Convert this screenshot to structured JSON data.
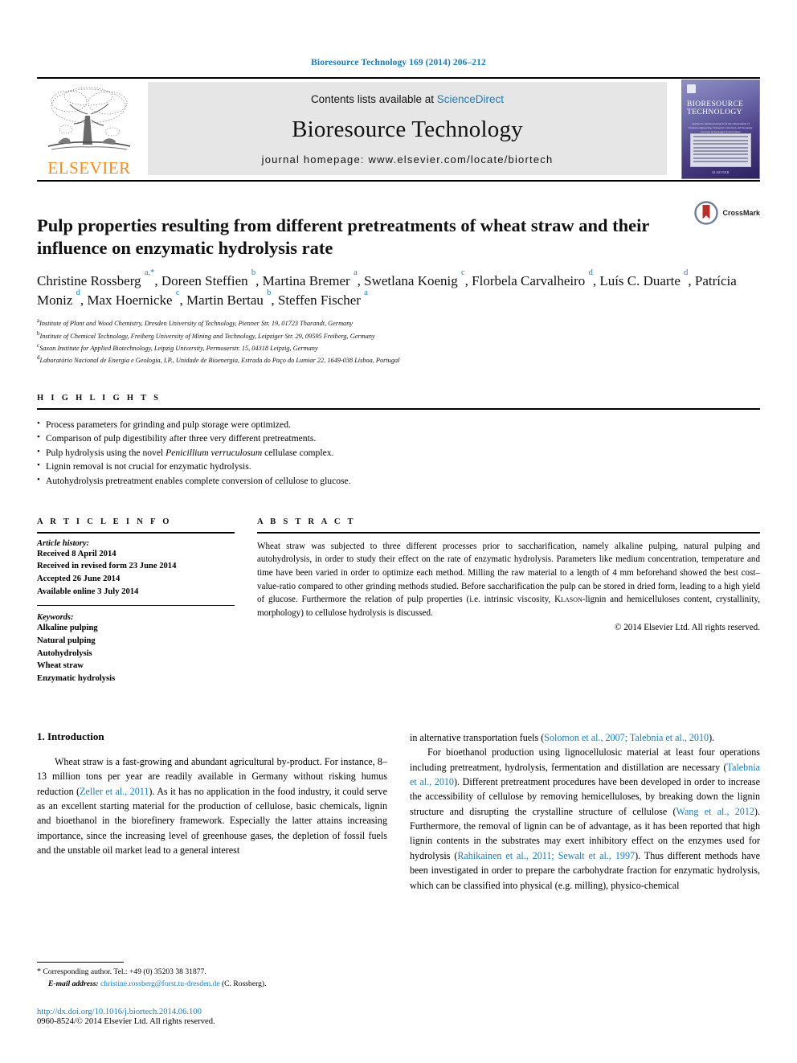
{
  "running_head": "Bioresource Technology 169 (2014) 206–212",
  "banner": {
    "publisher_logo_text": "ELSEVIER",
    "contents_prefix": "Contents lists available at ",
    "contents_link": "ScienceDirect",
    "journal_name": "Bioresource Technology",
    "homepage": "journal homepage: www.elsevier.com/locate/biortech",
    "cover_title_line1": "BIORESOURCE",
    "cover_title_line2": "TECHNOLOGY",
    "cover_subtitle": "Applied in chemical research for the advancement of biomass engineering, biological conversion and bioenergy recovery technologies from biomass",
    "cover_publisher": "ELSEVIER"
  },
  "article": {
    "title": "Pulp properties resulting from different pretreatments of wheat straw and their influence on enzymatic hydrolysis rate",
    "crossmark_label": "CrossMark",
    "authors_html": "Christine Rossberg <sup>a,*</sup>, Doreen Steffien <sup>b</sup>, Martina Bremer <sup>a</sup>, Swetlana Koenig <sup>c</sup>, Florbela Carvalheiro <sup>d</sup>, Luís C. Duarte <sup>d</sup>, Patrícia Moniz <sup>d</sup>, Max Hoernicke <sup>c</sup>, Martin Bertau <sup>b</sup>, Steffen Fischer <sup>a</sup>",
    "affiliations": [
      {
        "marker": "a",
        "text": "Institute of Plant and Wood Chemistry, Dresden University of Technology, Pienner Str. 19, 01723 Tharandt, Germany"
      },
      {
        "marker": "b",
        "text": "Institute of Chemical Technology, Freiberg University of Mining and Technology, Leipziger Str. 29, 09595 Freiberg, Germany"
      },
      {
        "marker": "c",
        "text": "Saxon Institute for Applied Biotechnology, Leipzig University, Permoserstr. 15, 04318 Leipzig, Germany"
      },
      {
        "marker": "d",
        "text": "Laboratório Nacional de Energia e Geologia, I.P., Unidade de Bioenergia, Estrada do Paço do Lumiar 22, 1649-038 Lisboa, Portugal"
      }
    ]
  },
  "highlights": {
    "heading": "H I G H L I G H T S",
    "items_html": [
      "Process parameters for grinding and pulp storage were optimized.",
      "Comparison of pulp digestibility after three very different pretreatments.",
      "Pulp hydrolysis using the novel <em>Penicillium verruculosum</em> cellulase complex.",
      "Lignin removal is not crucial for enzymatic hydrolysis.",
      "Autohydrolysis pretreatment enables complete conversion of cellulose to glucose."
    ]
  },
  "article_info": {
    "heading": "A R T I C L E    I N F O",
    "history_label": "Article history:",
    "history": [
      "Received 8 April 2014",
      "Received in revised form 23 June 2014",
      "Accepted 26 June 2014",
      "Available online 3 July 2014"
    ],
    "keywords_label": "Keywords:",
    "keywords": [
      "Alkaline pulping",
      "Natural pulping",
      "Autohydrolysis",
      "Wheat straw",
      "Enzymatic hydrolysis"
    ]
  },
  "abstract": {
    "heading": "A B S T R A C T",
    "body_html": "Wheat straw was subjected to three different processes prior to saccharification, namely alkaline pulping, natural pulping and autohydrolysis, in order to study their effect on the rate of enzymatic hydrolysis. Parameters like medium concentration, temperature and time have been varied in order to optimize each method. Milling the raw material to a length of 4 mm beforehand showed the best cost–value-ratio compared to other grinding methods studied. Before saccharification the pulp can be stored in dried form, leading to a high yield of glucose. Furthermore the relation of pulp properties (i.e. intrinsic viscosity, <span class=\"abs-smallcaps\">Klason</span>-lignin and hemicelluloses content, crystallinity, morphology) to cellulose hydrolysis is discussed.",
    "copyright": "© 2014 Elsevier Ltd. All rights reserved."
  },
  "introduction": {
    "heading": "1. Introduction",
    "left_paragraphs_html": [
      "Wheat straw is a fast-growing and abundant agricultural by-product. For instance, 8–13 million tons per year are readily available in Germany without risking humus reduction (<span class=\"ref\">Zeller et al., 2011</span>). As it has no application in the food industry, it could serve as an excellent starting material for the production of cellulose, basic chemicals, lignin and bioethanol in the biorefinery framework. Especially the latter attains increasing importance, since the increasing level of greenhouse gases, the depletion of fossil fuels and the unstable oil market lead to a general interest"
    ],
    "right_paragraphs_html": [
      "in alternative transportation fuels (<span class=\"ref\">Solomon et al., 2007; Talebnia et al., 2010</span>).",
      "For bioethanol production using lignocellulosic material at least four operations including pretreatment, hydrolysis, fermentation and distillation are necessary (<span class=\"ref\">Talebnia et al., 2010</span>). Different pretreatment procedures have been developed in order to increase the accessibility of cellulose by removing hemicelluloses, by breaking down the lignin structure and disrupting the crystalline structure of cellulose (<span class=\"ref\">Wang et al., 2012</span>). Furthermore, the removal of lignin can be of advantage, as it has been reported that high lignin contents in the substrates may exert inhibitory effect on the enzymes used for hydrolysis (<span class=\"ref\">Rahikainen et al., 2011; Sewalt et al., 1997</span>). Thus different methods have been investigated in order to prepare the carbohydrate fraction for enzymatic hydrolysis, which can be classified into physical (e.g. milling), physico-chemical"
    ]
  },
  "footnote": {
    "corresponding_html": "<span class=\"star\">*</span> Corresponding author. Tel.: +49 (0) 35203 38 31877.",
    "email_label": "E-mail address:",
    "email": "christine.rossberg@forst.tu-dresden.de",
    "email_suffix": "(C. Rossberg).",
    "doi": "http://dx.doi.org/10.1016/j.biortech.2014.06.100",
    "issn": "0960-8524/© 2014 Elsevier Ltd. All rights reserved."
  },
  "colors": {
    "link_blue": "#1a7bb9",
    "elsevier_orange": "#F28B22",
    "banner_grey": "#e6e6e6",
    "crossmark_red": "#b5312a"
  }
}
